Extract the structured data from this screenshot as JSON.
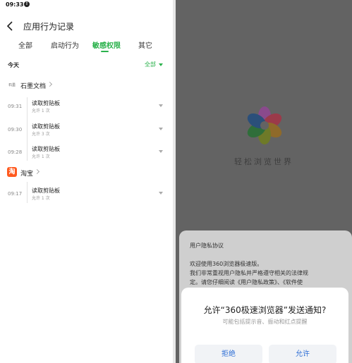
{
  "status_bar": {
    "time": "09:33",
    "battery": "99"
  },
  "header": {
    "title": "应用行为记录"
  },
  "tabs": [
    {
      "label": "全部"
    },
    {
      "label": "启动行为"
    },
    {
      "label": "敏感权限"
    },
    {
      "label": "其它"
    }
  ],
  "filter": {
    "section_label": "今天",
    "value": "全部"
  },
  "apps": [
    {
      "name": "石墨文档",
      "icon_text": "石墨",
      "events": [
        {
          "time": "09:31",
          "title": "读取剪贴板",
          "subtitle": "允许 1 次"
        },
        {
          "time": "09:30",
          "title": "读取剪贴板",
          "subtitle": "允许 3 次"
        },
        {
          "time": "09:28",
          "title": "读取剪贴板",
          "subtitle": "允许 1 次"
        }
      ]
    },
    {
      "name": "淘宝",
      "icon_text": "淘",
      "events": [
        {
          "time": "09:17",
          "title": "读取剪贴板",
          "subtitle": "允许 1 次"
        }
      ]
    }
  ],
  "splash": {
    "slogan": "轻松浏览世界"
  },
  "privacy": {
    "title": "用户隐私协议",
    "lines": [
      "欢迎使用360浏览器极速版。",
      "我们非常重视用户隐私并严格遵守相关的法律规",
      "定。请您仔细阅读《用户隐私政策》、《软件使"
    ]
  },
  "dialog": {
    "title": "允许“360极速浏览器”发送通知?",
    "subtitle": "可能包括提示音、振动和红点提醒",
    "deny_label": "拒绝",
    "allow_label": "允许"
  },
  "colors": {
    "accent": "#2bb24c",
    "dialog_button_text": "#2f6fd6",
    "taobao": "#ff5a1f",
    "overlay": "#636363"
  }
}
